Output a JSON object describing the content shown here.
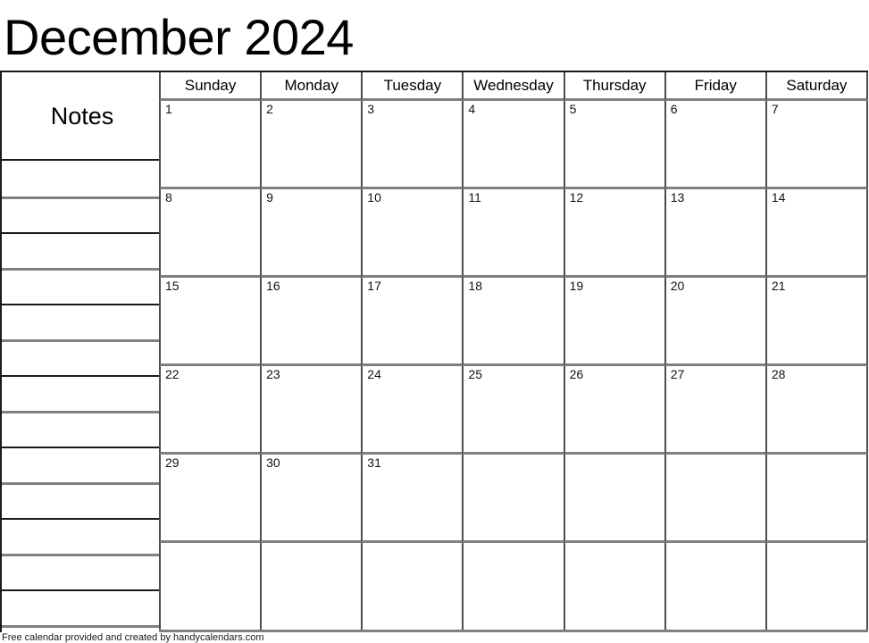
{
  "title": "December 2024",
  "month": "December",
  "year": "2024",
  "notes": {
    "header_label": "Notes",
    "line_count": 13
  },
  "weekdays": [
    "Sunday",
    "Monday",
    "Tuesday",
    "Wednesday",
    "Thursday",
    "Friday",
    "Saturday"
  ],
  "weeks": [
    [
      "1",
      "2",
      "3",
      "4",
      "5",
      "6",
      "7"
    ],
    [
      "8",
      "9",
      "10",
      "11",
      "12",
      "13",
      "14"
    ],
    [
      "15",
      "16",
      "17",
      "18",
      "19",
      "20",
      "21"
    ],
    [
      "22",
      "23",
      "24",
      "25",
      "26",
      "27",
      "28"
    ],
    [
      "29",
      "30",
      "31",
      "",
      "",
      "",
      ""
    ],
    [
      "",
      "",
      "",
      "",
      "",
      "",
      ""
    ]
  ],
  "footer": {
    "text": "Free calendar provided and created by handycalendars.com"
  },
  "colors": {
    "ink": "#000000",
    "grid_dark": "#1a1a1a",
    "grid_medium": "#4d4d4d",
    "grid_light": "#808080",
    "background": "#ffffff"
  }
}
